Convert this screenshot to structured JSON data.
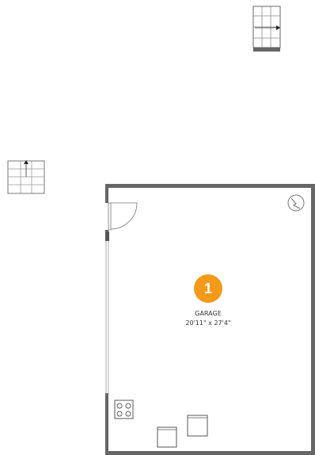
{
  "floorplan": {
    "rooms": [
      {
        "number": "1",
        "name": "GARAGE",
        "dimensions": "20'11\" x 27'4\""
      }
    ],
    "colors": {
      "wall": "#666666",
      "fixture_line": "#555555",
      "badge": "#f39a1b",
      "badge_text": "#ffffff",
      "label_text": "#333333"
    },
    "icons": [
      "staircase-icon",
      "staircase-icon",
      "electrical-panel-icon",
      "stove-icon",
      "appliance-icon",
      "appliance-icon",
      "door-swing-icon"
    ]
  }
}
